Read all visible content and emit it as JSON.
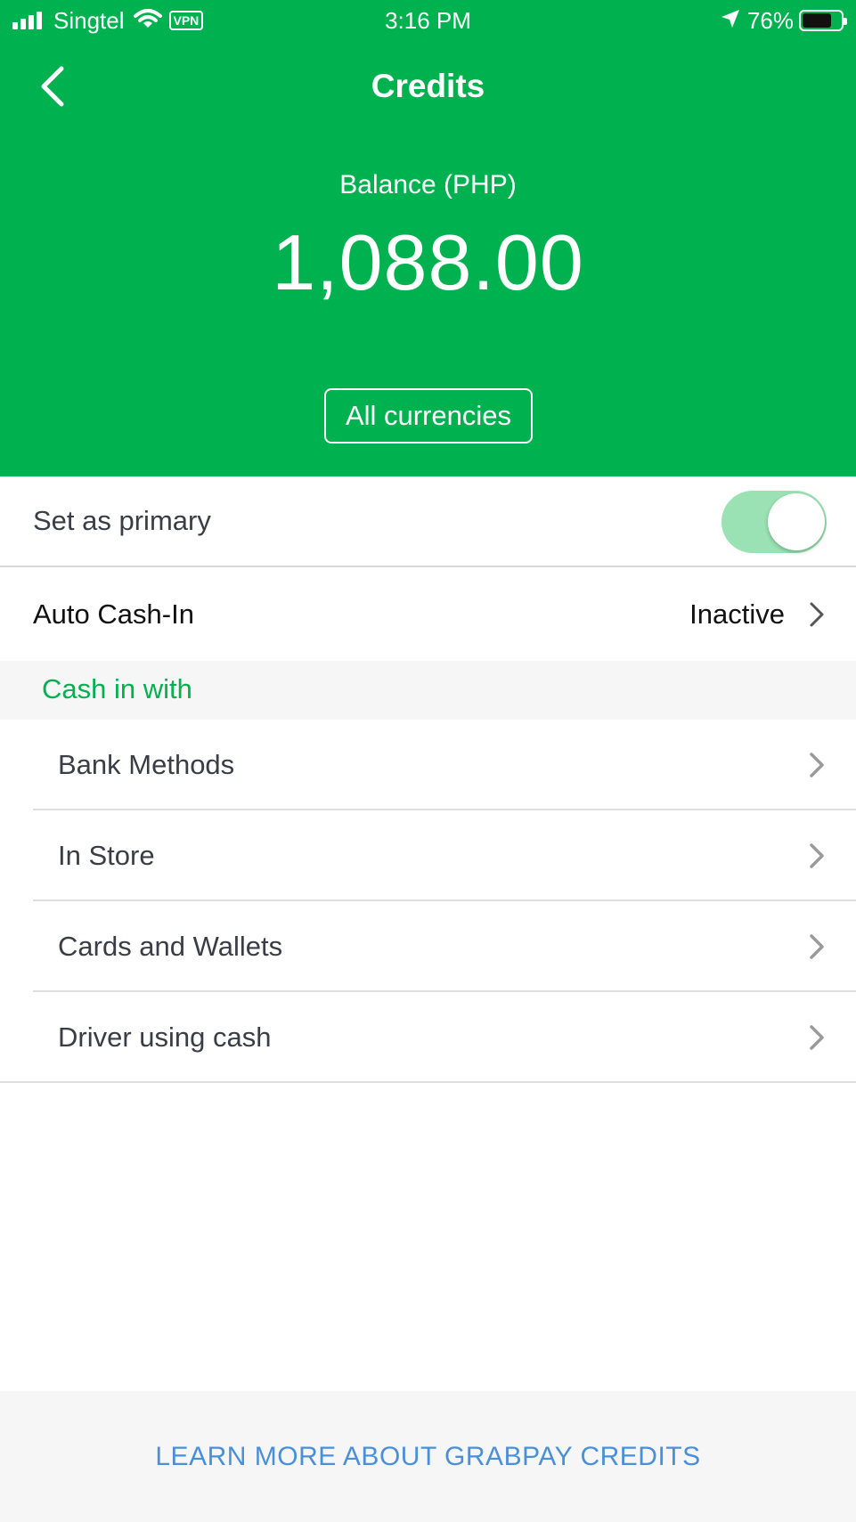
{
  "status_bar": {
    "carrier": "Singtel",
    "vpn_label": "VPN",
    "time": "3:16 PM",
    "battery_percent": "76%",
    "battery_level": 0.76,
    "signal_bars": 4,
    "icons": [
      "signal-icon",
      "wifi-icon",
      "vpn-icon",
      "location-arrow-icon",
      "battery-icon"
    ]
  },
  "header": {
    "title": "Credits",
    "back_icon": "chevron-left-icon",
    "balance_label": "Balance (PHP)",
    "balance_amount": "1,088.00",
    "all_currencies_label": "All currencies"
  },
  "settings": {
    "primary_label": "Set as primary",
    "primary_enabled": true,
    "auto_cash_in_label": "Auto Cash-In",
    "auto_cash_in_status": "Inactive"
  },
  "cash_in": {
    "section_title": "Cash in with",
    "methods": [
      {
        "label": "Bank Methods"
      },
      {
        "label": "In Store"
      },
      {
        "label": "Cards and Wallets"
      },
      {
        "label": "Driver using cash"
      }
    ]
  },
  "footer": {
    "learn_more_label": "LEARN MORE ABOUT GRABPAY CREDITS"
  },
  "colors": {
    "brand_green": "#00b14f",
    "toggle_on": "#9ae2b3",
    "link_blue": "#4a90d9",
    "section_bg": "#f6f6f6"
  }
}
